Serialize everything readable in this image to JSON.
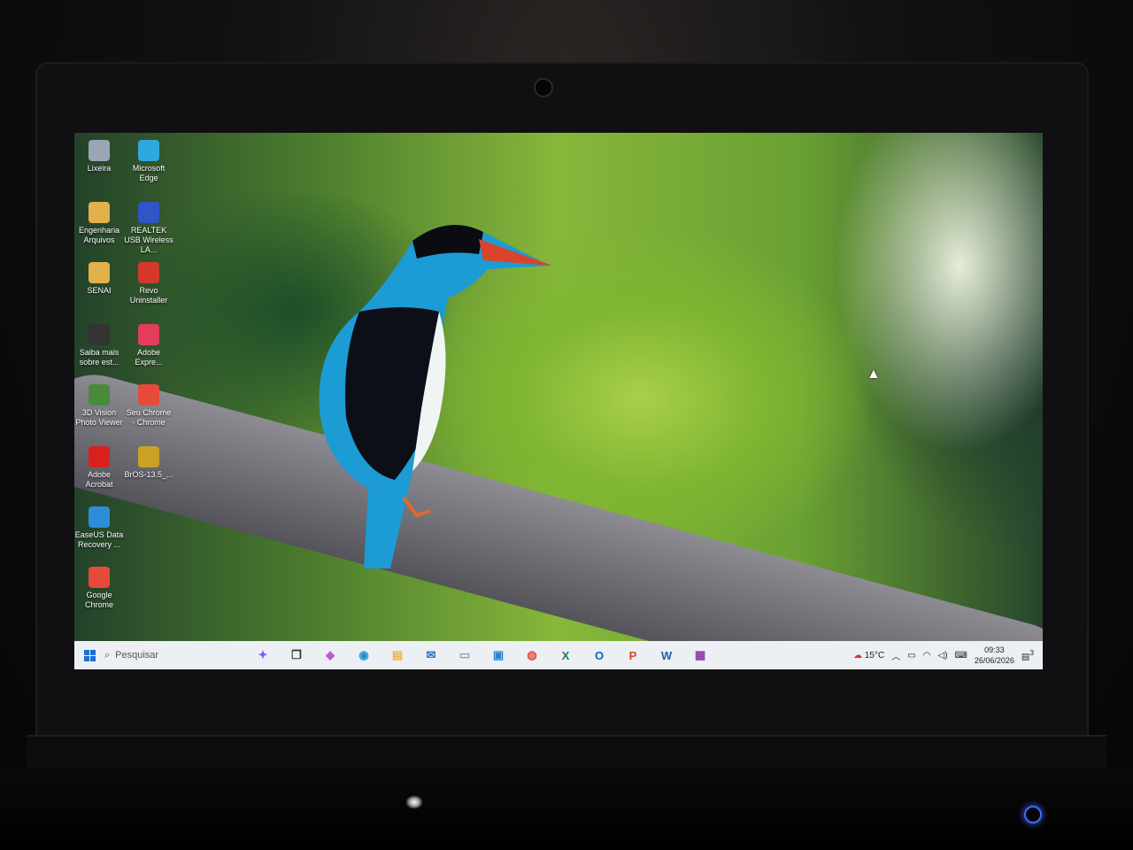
{
  "desktop": {
    "icons": [
      {
        "label": "Lixeira",
        "color": "#9aa5b5"
      },
      {
        "label": "Microsoft Edge",
        "color": "#2fa8e0"
      },
      {
        "label": "Engenharia Arquivos",
        "color": "#e2b14b"
      },
      {
        "label": "REALTEK USB Wireless LA...",
        "color": "#2f55c7"
      },
      {
        "label": "SENAI",
        "color": "#e2b14b"
      },
      {
        "label": "Revo Uninstaller",
        "color": "#d33a2c"
      },
      {
        "label": "Saiba mais sobre est...",
        "color": "#333333"
      },
      {
        "label": "Adobe Expre...",
        "color": "#e23d5a"
      },
      {
        "label": "3D Vision Photo Viewer",
        "color": "#4a8b3a"
      },
      {
        "label": "Seu Chrome - Chrome",
        "color": "#e64a3b"
      },
      {
        "label": "Adobe Acrobat",
        "color": "#d8211d"
      },
      {
        "label": "BrOS-13.5_...",
        "color": "#c9a227"
      },
      {
        "label": "EaseUS Data Recovery ...",
        "color": "#2c8ed6"
      },
      {
        "label": "Google Chrome",
        "color": "#e64a3b"
      }
    ]
  },
  "taskbar": {
    "search_placeholder": "Pesquisar",
    "pinned": [
      {
        "name": "copilot-icon",
        "glyph": "✦",
        "color": "#7a5cf0"
      },
      {
        "name": "task-view-icon",
        "glyph": "❐",
        "color": "#333333"
      },
      {
        "name": "copilot-app-icon",
        "glyph": "◆",
        "color": "#c157d3"
      },
      {
        "name": "edge-icon",
        "glyph": "◉",
        "color": "#1a8fd9"
      },
      {
        "name": "file-explorer-icon",
        "glyph": "▤",
        "color": "#e5b64b"
      },
      {
        "name": "outlook-new-icon",
        "glyph": "✉",
        "color": "#1a73c8"
      },
      {
        "name": "notepad-icon",
        "glyph": "▭",
        "color": "#8aa0b3"
      },
      {
        "name": "remote-desktop-icon",
        "glyph": "▣",
        "color": "#2b86d6"
      },
      {
        "name": "chrome-icon",
        "glyph": "◍",
        "color": "#e64a3b"
      },
      {
        "name": "excel-icon",
        "glyph": "X",
        "color": "#1e7d45"
      },
      {
        "name": "outlook-icon",
        "glyph": "O",
        "color": "#0f63b8"
      },
      {
        "name": "powerpoint-icon",
        "glyph": "P",
        "color": "#d24726"
      },
      {
        "name": "word-icon",
        "glyph": "W",
        "color": "#2a5caa"
      },
      {
        "name": "winrar-icon",
        "glyph": "▦",
        "color": "#8d3aa8"
      }
    ],
    "weather": "15°C",
    "time": "09:33",
    "date": "26/06/2026",
    "notification_count": "3"
  }
}
